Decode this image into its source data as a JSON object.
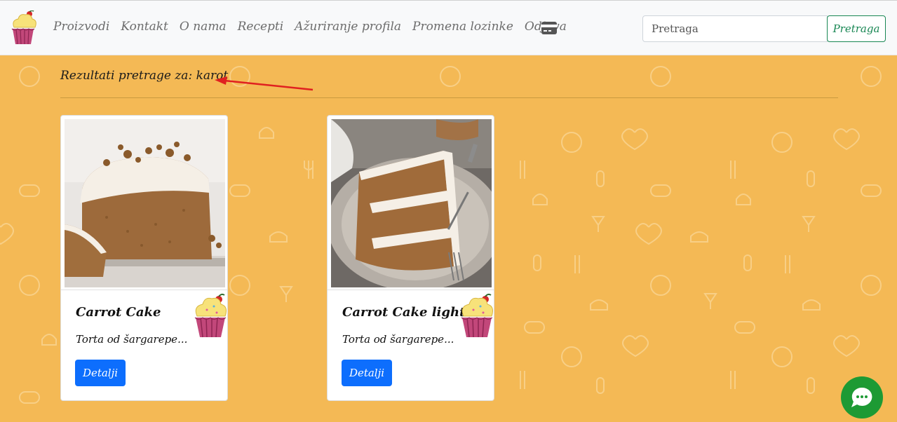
{
  "nav": {
    "links": [
      "Proizvodi",
      "Kontakt",
      "O nama",
      "Recepti",
      "Ažuriranje profila",
      "Promena lozinke",
      "Odjava"
    ],
    "cart_icon": "credit-card-icon",
    "search_placeholder": "Pretraga",
    "search_button": "Pretraga"
  },
  "results": {
    "heading": "Rezultati pretrage za: karot"
  },
  "cards": [
    {
      "title": "Carrot Cake",
      "description": "Torta od šargarepe...",
      "button": "Detalji"
    },
    {
      "title": "Carrot Cake light",
      "description": "Torta od šargarepe...",
      "button": "Detalji"
    }
  ],
  "colors": {
    "background": "#f4b955",
    "primary": "#0d6efd",
    "success": "#198754",
    "chat": "#1d9a34"
  }
}
